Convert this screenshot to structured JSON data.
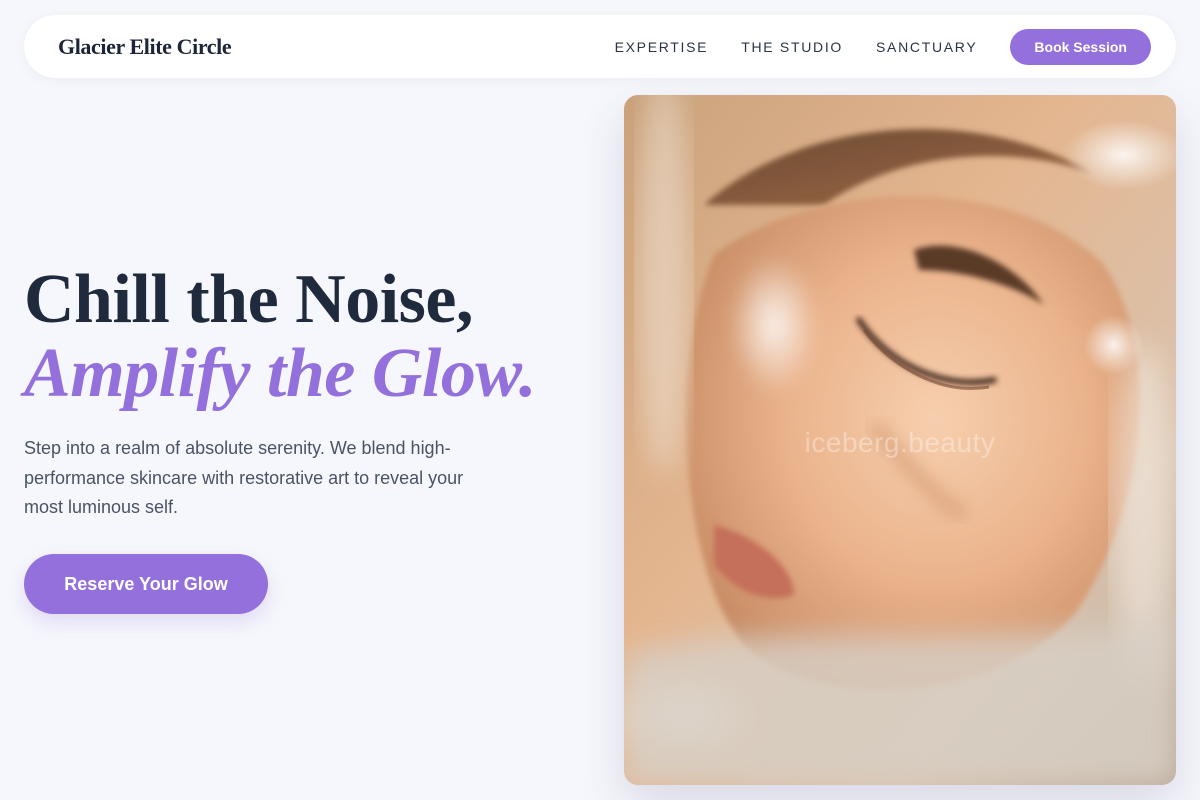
{
  "header": {
    "brand": "Glacier Elite Circle",
    "nav": [
      {
        "label": "EXPERTISE"
      },
      {
        "label": "THE STUDIO"
      },
      {
        "label": "SANCTUARY"
      }
    ],
    "cta_label": "Book Session"
  },
  "hero": {
    "title_line1": "Chill the Noise,",
    "title_line2": "Amplify the Glow.",
    "description": "Step into a realm of absolute serenity. We blend high-performance skincare with restorative art to reveal your most luminous self.",
    "cta_label": "Reserve Your Glow",
    "image": {
      "subject": "close-up portrait of a face with eyes closed in warm glowing light",
      "watermark": "iceberg.beauty"
    }
  },
  "colors": {
    "accent": "#9370db",
    "heading": "#1f2a3d",
    "body_text": "#4a5365",
    "background": "#f6f7fc"
  }
}
